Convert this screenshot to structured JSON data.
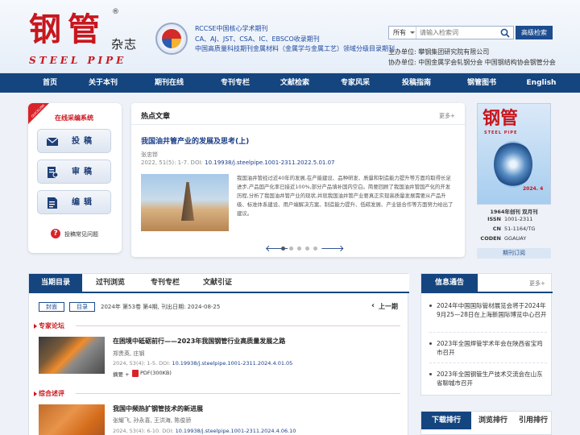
{
  "header": {
    "logo_cn": "钢管",
    "logo_reg": "®",
    "logo_zazhi": "杂志",
    "logo_en": "STEEL PIPE",
    "badge_label": "中国科技期刊",
    "index_lines": [
      "RCCSE中国核心学术期刊",
      "CA、AJ、JST、CSA、IC、EBSCO收录期刊",
      "中国高质量科技期刊金属材料（金属学与金属工艺）领域分级目录期刊"
    ],
    "search": {
      "scope": "所有",
      "placeholder": "请输入检索词",
      "advanced_label": "高级检索"
    },
    "sponsor_line": "主办单位:   攀钢集团研究院有限公司",
    "co_sponsor_line": "协办单位:   中国金属学会轧钢分会     中国钢结构协会钢管分会"
  },
  "nav": {
    "items": [
      "首页",
      "关于本刊",
      "期刊在线",
      "专刊专栏",
      "文献检索",
      "专家风采",
      "投稿指南",
      "钢管图书",
      "English"
    ]
  },
  "left_panel": {
    "tag": "QUICKLINK",
    "title": "在线采编系统",
    "buttons": [
      "投稿",
      "审稿",
      "编辑"
    ],
    "faq": "投稿常见问题",
    "faq_icon": "?"
  },
  "hot": {
    "title": "热点文章",
    "more": "更多+",
    "article_title": "我国油井管产业的发展及思考(上)",
    "author": "张忠铧",
    "meta": "2022, 51(5): 1-7. DOI: ",
    "doi": "10.19938/j.steelpipe.1001-2311.2022.5.01.07",
    "abstract": "我国油井管经过近40年的发展,在产能建设、品种研发、质量和制造能力提升等方面均取得长足进步,产品国产化率已接近100%,部分产品填补国内空白。简要回顾了我国油井管国产化的开发历程,分析了我国油井管产业的现状,并就我国油井管产业要真正实现高质量发展需要从产品升级、标准体系建设、用户端解决方案、制造能力提升、低碳发展、产业链合作等方面努力给出了建议。",
    "prev": "🡐",
    "next": "🡒",
    "slide_count": 5,
    "active_slide": 0
  },
  "cover": {
    "title_cn": "钢管",
    "title_en": "STEEL PIPE",
    "issue_mark": "2024. 4",
    "founded": "1964年创刊   双月刊",
    "issn_label": "ISSN",
    "issn": "1001-2311",
    "cn_label": "CN",
    "cn": "51-1164/TG",
    "coden_label": "CODEN",
    "coden": "GGAUAY",
    "subscribe": "期刊订阅"
  },
  "issue": {
    "tabs": [
      "当期目录",
      "过刊浏览",
      "专刊专栏",
      "文献引证"
    ],
    "active_tab": 0,
    "btn_cover": "封面",
    "btn_toc": "目录",
    "info": "2024年 第53卷 第4期, 刊出日期: 2024-08-25",
    "prev_issue": "上一期",
    "sections": [
      {
        "name": "专家论坛",
        "articles": [
          {
            "title": "在困境中砥砺前行——2023年我国钢管行业高质量发展之路",
            "authors": "郑贵英, 庄钢",
            "meta": "2024, 53(4): 1-5. DOI: ",
            "doi": "10.19938/j.steelpipe.1001-2311.2024.4.01.05",
            "abstract_label": "摘要 +",
            "pdf_label": "PDF(300KB)"
          }
        ]
      },
      {
        "name": "综合述评",
        "articles": [
          {
            "title": "我国中频热扩钢管技术的新进展",
            "authors": "张耀飞, 孙永喜, 王洪海, 陈俊骄",
            "meta": "2024, 53(4): 6-10. DOI: ",
            "doi": "10.19938/j.steelpipe.1001-2311.2024.4.06.10"
          }
        ]
      }
    ]
  },
  "news": {
    "title": "信息通告",
    "more": "更多+",
    "items": [
      "2024年中国国际管材展览会将于2024年9月25—28日在上海新国际博览中心召开",
      "2023年全国焊管学术年会在陕西省宝鸡市召开",
      "2023年全国钢管生产技术交流会在山东省聊城市召开"
    ]
  },
  "rank": {
    "tabs": [
      "下载排行",
      "浏览排行",
      "引用排行"
    ],
    "active_tab": 0
  },
  "colors": {
    "brand_red": "#c8161d",
    "nav_blue": "#14457f",
    "link_blue": "#1a3e88"
  }
}
